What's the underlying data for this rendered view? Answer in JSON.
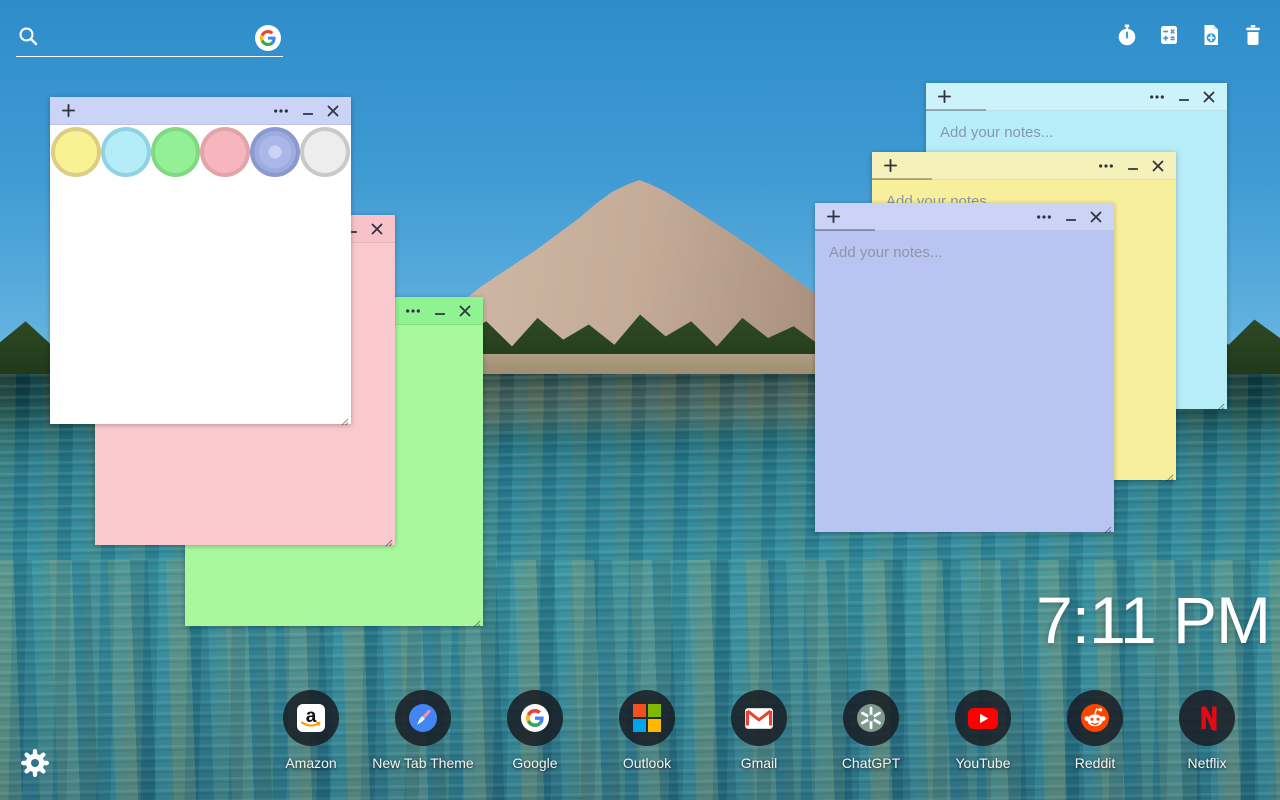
{
  "topbar": {
    "search": {
      "value": "",
      "icon": "search-icon",
      "engine_icon": "google-logo"
    },
    "action_icons": [
      {
        "name": "timer-icon"
      },
      {
        "name": "calculator-icon"
      },
      {
        "name": "new-note-icon"
      },
      {
        "name": "delete-all-icon"
      }
    ]
  },
  "notes": {
    "placeholder": "Add your notes...",
    "palette": {
      "selected": "periwinkle",
      "colors": [
        {
          "name": "yellow",
          "hex": "#f9f295"
        },
        {
          "name": "cyan",
          "hex": "#b4ecf8"
        },
        {
          "name": "green",
          "hex": "#94f094"
        },
        {
          "name": "pink",
          "hex": "#f5b7bd"
        },
        {
          "name": "periwinkle",
          "hex": "#9dabde"
        },
        {
          "name": "white",
          "hex": "#ededed"
        }
      ]
    },
    "items": [
      {
        "color": "white",
        "state": "color-picker-open"
      },
      {
        "color": "pink"
      },
      {
        "color": "green"
      },
      {
        "color": "cyan"
      },
      {
        "color": "yellow"
      },
      {
        "color": "periwinkle"
      }
    ],
    "titlebar_icons": [
      "add-note",
      "menu-dots",
      "minimize",
      "close"
    ]
  },
  "clock": {
    "time": "7:11 PM"
  },
  "dock": {
    "items": [
      {
        "label": "Amazon",
        "icon": "amazon-icon"
      },
      {
        "label": "New Tab Theme",
        "icon": "paintbrush-icon"
      },
      {
        "label": "Google",
        "icon": "google-icon"
      },
      {
        "label": "Outlook",
        "icon": "outlook-icon"
      },
      {
        "label": "Gmail",
        "icon": "gmail-icon"
      },
      {
        "label": "ChatGPT",
        "icon": "chatgpt-icon"
      },
      {
        "label": "YouTube",
        "icon": "youtube-icon"
      },
      {
        "label": "Reddit",
        "icon": "reddit-icon"
      },
      {
        "label": "Netflix",
        "icon": "netflix-icon"
      }
    ]
  },
  "settings": {
    "icon": "gear-icon"
  },
  "colors": {
    "note_titlebar_periwinkle": "#cbd3f7",
    "note_yellow": "#f8ef9c",
    "note_cyan": "#b7edf8",
    "note_green": "#a8f89e",
    "note_pink": "#f9c9ce",
    "note_periwinkle": "#b9c4f2",
    "placeholder_text": "#8a97a6",
    "clock_text": "#ffffff",
    "netflix_red": "#e50914",
    "youtube_red": "#ff0000",
    "reddit_orange": "#ff4500",
    "amazon_smile": "#ff9900",
    "theme_blue": "#4285f4",
    "sky_blue": "#3f9ad3"
  }
}
